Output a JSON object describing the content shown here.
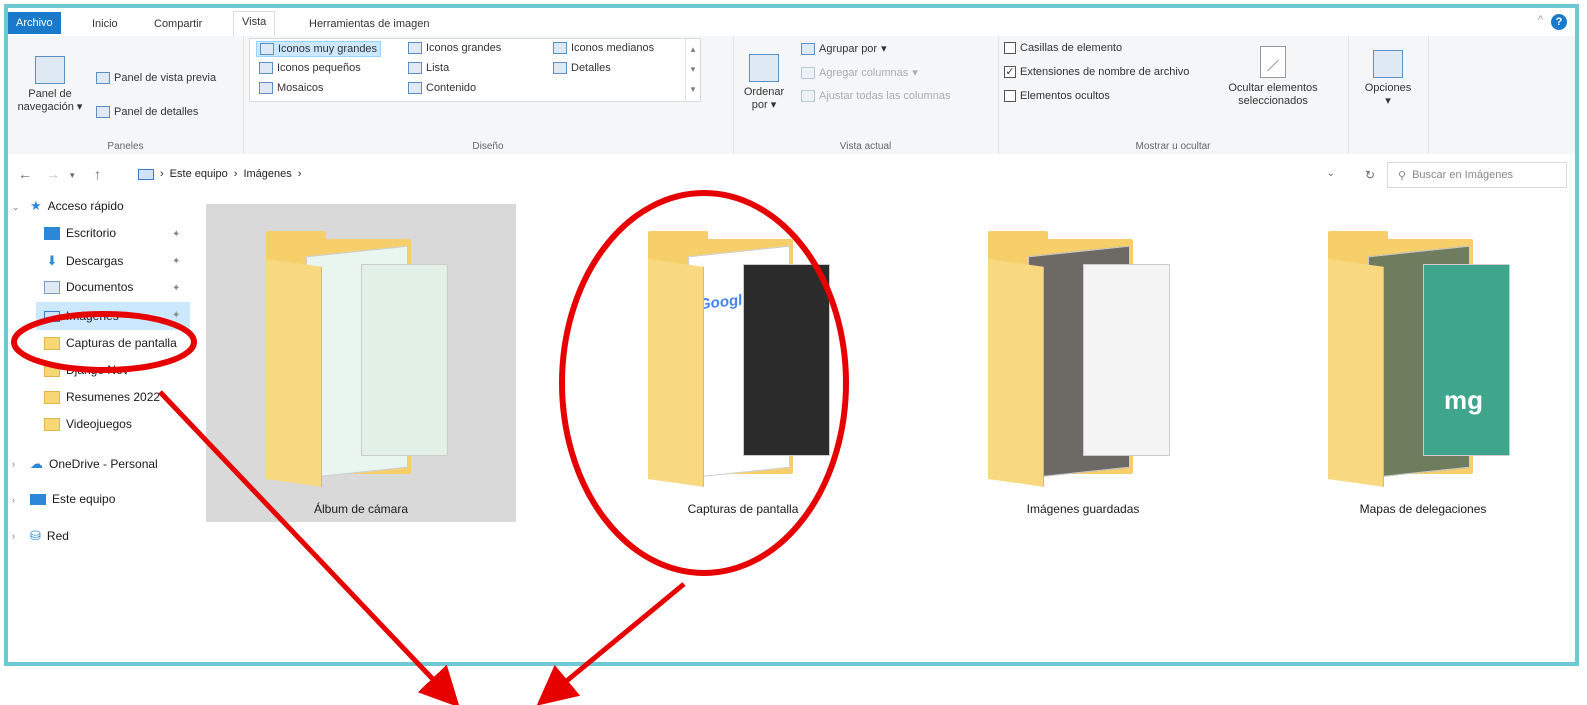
{
  "tabs": {
    "file": "Archivo",
    "items": [
      "Inicio",
      "Compartir",
      "Vista",
      "Herramientas de imagen"
    ]
  },
  "ribbon": {
    "paneles": {
      "nav_pane_line1": "Panel de",
      "nav_pane_line2": "navegación",
      "preview": "Panel de vista previa",
      "details": "Panel de detalles",
      "label": "Paneles"
    },
    "diseno": {
      "items": [
        "Iconos muy grandes",
        "Iconos grandes",
        "Iconos medianos",
        "Iconos pequeños",
        "Lista",
        "Detalles",
        "Mosaicos",
        "Contenido"
      ],
      "selected": "Iconos muy grandes",
      "label": "Diseño"
    },
    "vista_actual": {
      "sort_line1": "Ordenar",
      "sort_line2": "por",
      "group_by": "Agrupar por",
      "add_columns": "Agregar columnas",
      "fit_columns": "Ajustar todas las columnas",
      "label": "Vista actual"
    },
    "mostrar": {
      "item_checkboxes": "Casillas de elemento",
      "item_checkboxes_checked": false,
      "extensions": "Extensiones de nombre de archivo",
      "extensions_checked": true,
      "hidden": "Elementos ocultos",
      "hidden_checked": false,
      "hide_selected_line1": "Ocultar elementos",
      "hide_selected_line2": "seleccionados",
      "label": "Mostrar u ocultar"
    },
    "options": "Opciones"
  },
  "address": {
    "segments": [
      "Este equipo",
      "Imágenes"
    ],
    "search_placeholder": "Buscar en Imágenes"
  },
  "sidebar": {
    "quick_access": "Acceso rápido",
    "items": [
      "Escritorio",
      "Descargas",
      "Documentos",
      "Imágenes",
      "Capturas de pantalla",
      "Django Nov",
      "Resumenes 2022",
      "Videojuegos"
    ],
    "selected": "Imágenes",
    "onedrive": "OneDrive - Personal",
    "this_pc": "Este equipo",
    "network": "Red"
  },
  "folders": [
    "Álbum de cámara",
    "Capturas de pantalla",
    "Imágenes guardadas",
    "Mapas de delegaciones"
  ],
  "thumb_texts": {
    "google": "Google",
    "mg": "mg"
  },
  "colors": {
    "accent": "#1979ca",
    "frame": "#6ec9d4",
    "selection": "#cce8ff",
    "annotation": "#e60000",
    "folder": "#f6cf6b"
  },
  "icons": [
    "back-arrow-icon",
    "forward-arrow-icon",
    "up-arrow-icon",
    "refresh-icon",
    "search-icon",
    "pin-icon",
    "folder-icon",
    "star-icon",
    "cloud-icon",
    "computer-icon",
    "network-icon",
    "help-icon"
  ]
}
